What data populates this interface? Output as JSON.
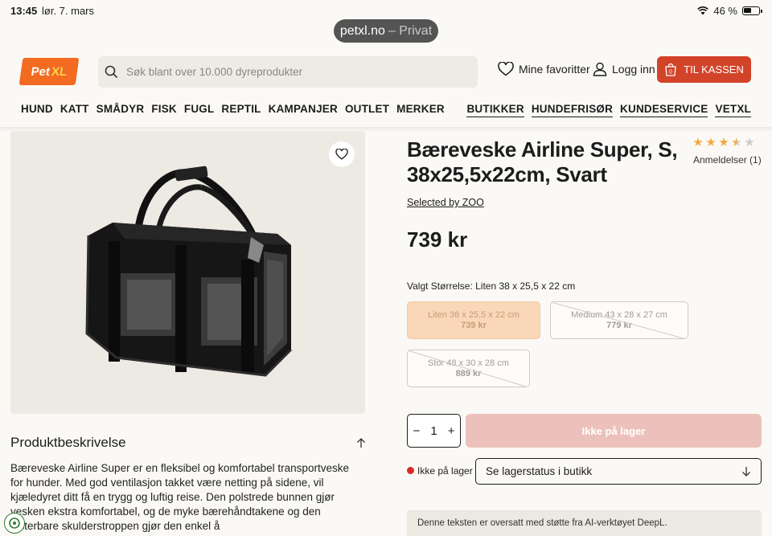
{
  "status_bar": {
    "time": "13:45",
    "date": "lør. 7. mars",
    "battery": "46 %",
    "battery_level": 0.46
  },
  "browser": {
    "domain": "petxl.no",
    "mode": "– Privat"
  },
  "header": {
    "logo_pet": "Pet",
    "logo_xl": "XL",
    "search_placeholder": "Søk blant over 10.000 dyreprodukter",
    "favorites": "Mine favoritter",
    "login": "Logg inn",
    "cart_count": "0",
    "checkout": "TIL KASSEN"
  },
  "nav": {
    "left": [
      "HUND",
      "KATT",
      "SMÅDYR",
      "FISK",
      "FUGL",
      "REPTIL",
      "KAMPANJER",
      "OUTLET",
      "MERKER"
    ],
    "right": [
      "BUTIKKER",
      "HUNDEFRISØR",
      "KUNDESERVICE",
      "VETXL"
    ]
  },
  "product": {
    "title": "Bæreveske Airline Super, S, 38x25,5x22cm, Svart",
    "brand": "Selected by ZOO",
    "price": "739 kr",
    "rating": 3.5,
    "rating_max": 5,
    "reviews": "Anmeldelser (1)",
    "size_label": "Valgt Størrelse: Liten 38 x 25,5 x 22 cm",
    "sizes": [
      {
        "name": "Liten 38 x 25,5 x 22 cm",
        "price": "739 kr"
      },
      {
        "name": "Medium 43 x 28 x 27 cm",
        "price": "779 kr"
      },
      {
        "name": "Stor 48 x 30 x 28 cm",
        "price": "889 kr"
      }
    ],
    "qty_minus": "−",
    "qty": "1",
    "qty_plus": "+",
    "add_button": "Ikke på lager",
    "stock_status": "Ikke på lager",
    "store_select": "Se lagerstatus i butikk"
  },
  "description": {
    "title": "Produktbeskrivelse",
    "body": "Bæreveske Airline Super er en fleksibel og komfortabel transportveske for hunder. Med god ventilasjon takket være netting på sidene, vil kjæledyret ditt få en trygg og luftig reise. Den polstrede bunnen gjør vesken ekstra komfortabel, og de myke bærehåndtakene og den justerbare skulderstroppen gjør den enkel å"
  },
  "notice": "Denne teksten er oversatt med støtte fra AI-verktøyet DeepL.",
  "colors": {
    "brand_orange": "#f26b21",
    "checkout_red": "#d2442a",
    "star": "#f4a83b",
    "out_of_stock": "#d9292b"
  }
}
